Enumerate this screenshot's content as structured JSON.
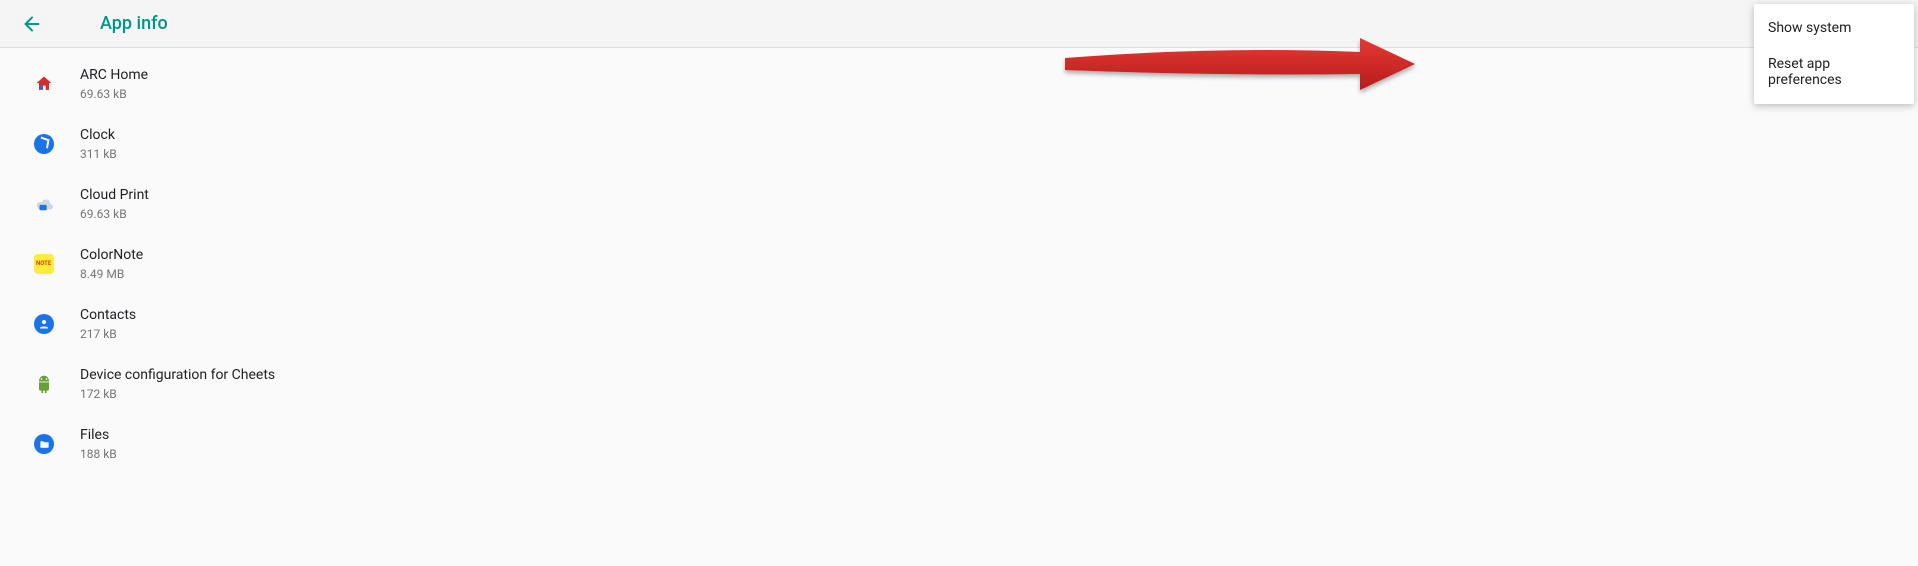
{
  "header": {
    "title": "App info"
  },
  "apps": [
    {
      "name": "ARC Home",
      "size": "69.63 kB",
      "icon": "arc-home-icon"
    },
    {
      "name": "Clock",
      "size": "311 kB",
      "icon": "clock-icon"
    },
    {
      "name": "Cloud Print",
      "size": "69.63 kB",
      "icon": "cloud-print-icon"
    },
    {
      "name": "ColorNote",
      "size": "8.49 MB",
      "icon": "colornote-icon"
    },
    {
      "name": "Contacts",
      "size": "217 kB",
      "icon": "contacts-icon"
    },
    {
      "name": "Device configuration for Cheets",
      "size": "172 kB",
      "icon": "android-icon"
    },
    {
      "name": "Files",
      "size": "188 kB",
      "icon": "files-icon"
    }
  ],
  "menu": {
    "items": [
      {
        "label": "Show system"
      },
      {
        "label": "Reset app preferences"
      }
    ]
  },
  "annotation": {
    "type": "arrow",
    "color": "#c90000"
  }
}
